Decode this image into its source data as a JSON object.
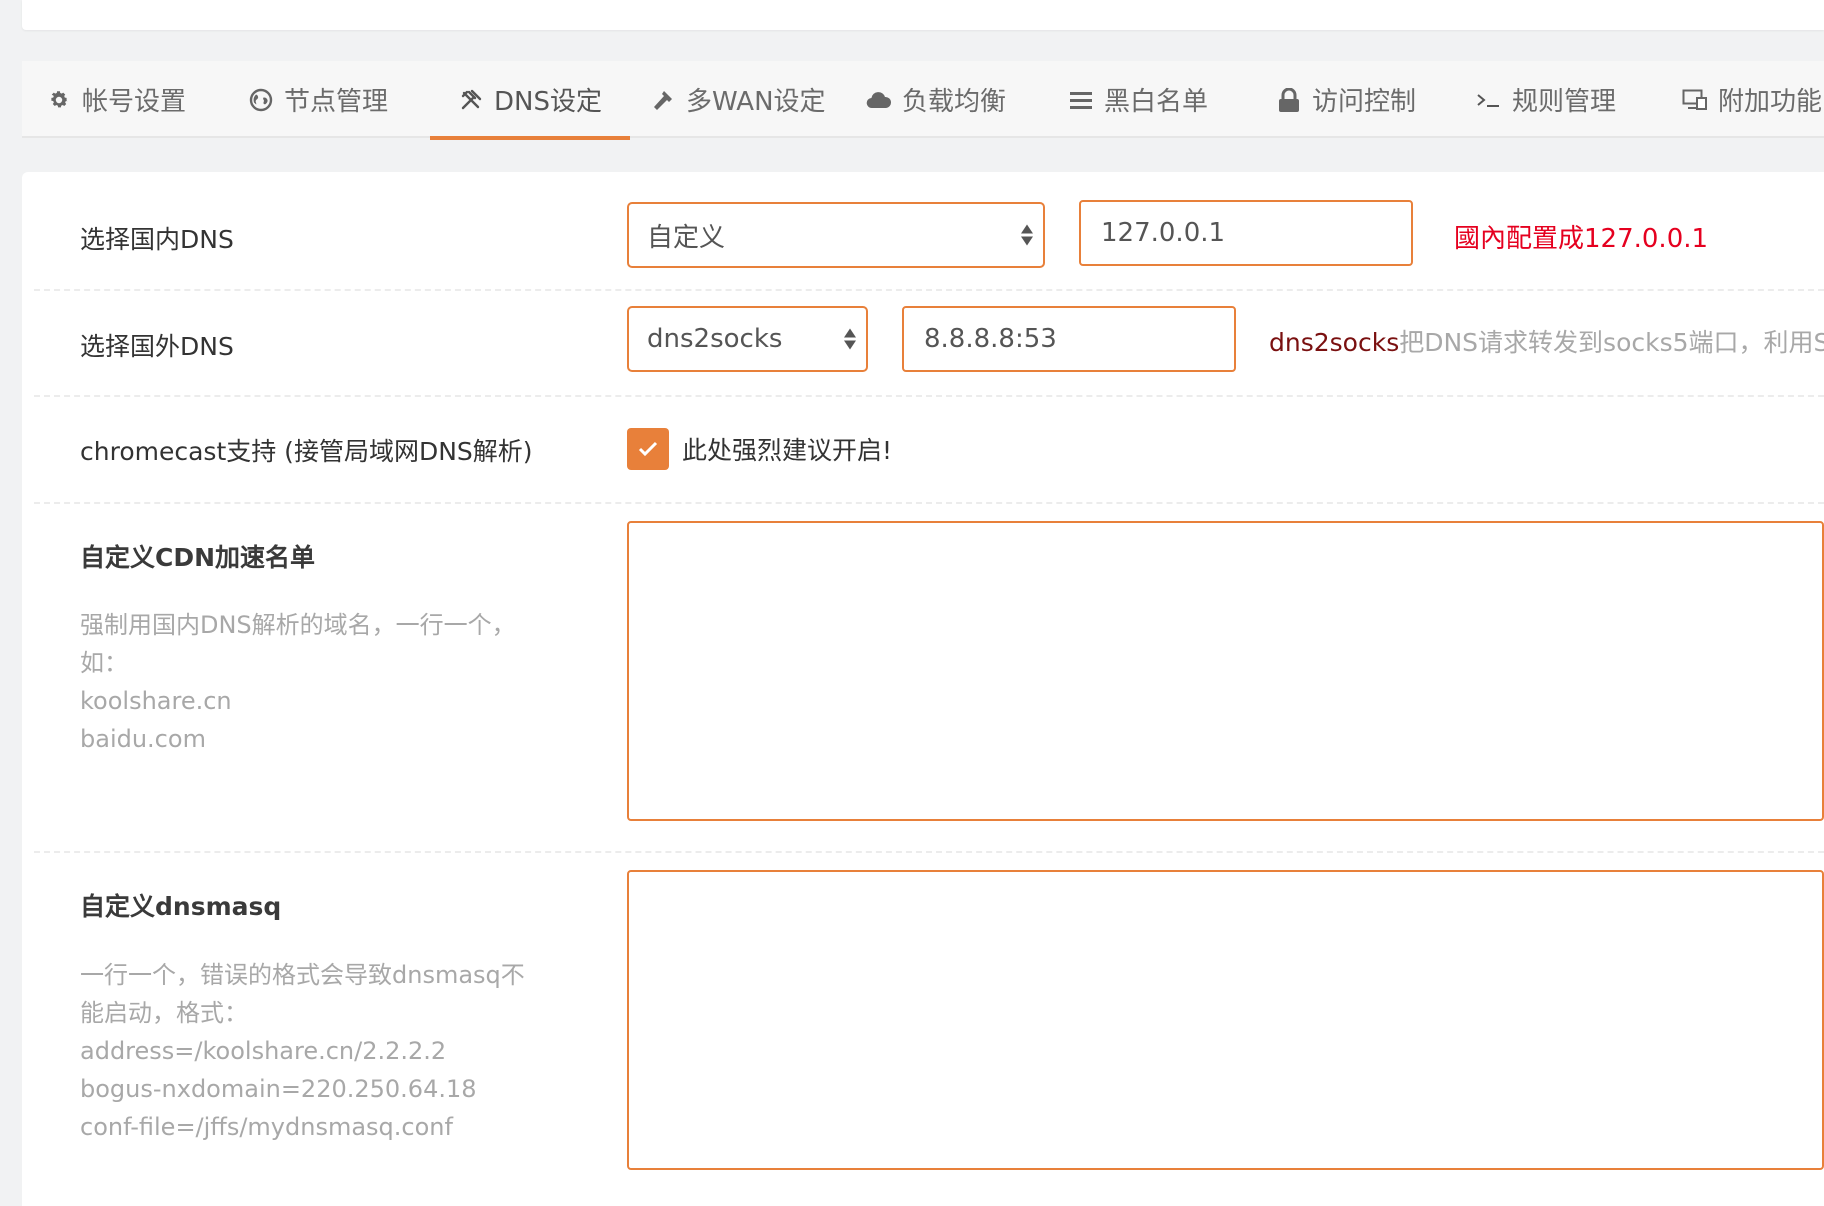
{
  "tabs": [
    {
      "label": "帐号设置",
      "icon": "gear-icon"
    },
    {
      "label": "节点管理",
      "icon": "globe-icon"
    },
    {
      "label": "DNS设定",
      "icon": "tools-icon",
      "active": true
    },
    {
      "label": "多WAN设定",
      "icon": "hammer-icon"
    },
    {
      "label": "负载均衡",
      "icon": "cloud-icon"
    },
    {
      "label": "黑白名单",
      "icon": "list-icon"
    },
    {
      "label": "访问控制",
      "icon": "lock-icon"
    },
    {
      "label": "规则管理",
      "icon": "terminal-icon"
    },
    {
      "label": "附加功能",
      "icon": "monitor-icon"
    }
  ],
  "domestic_dns": {
    "label": "选择国内DNS",
    "select_value": "自定义",
    "input_value": "127.0.0.1",
    "note": "國內配置成127.0.0.1"
  },
  "foreign_dns": {
    "label": "选择国外DNS",
    "select_value": "dns2socks",
    "input_value": "8.8.8.8:53",
    "note_prefix": "dns2socks",
    "note_rest": "把DNS请求转发到socks5端口，利用S"
  },
  "chromecast": {
    "label": "chromecast支持 (接管局域网DNS解析)",
    "checked": true,
    "check_text": "此处强烈建议开启!"
  },
  "cdn_list": {
    "label": "自定义CDN加速名单",
    "hint_lines": [
      "强制用国内DNS解析的域名，一行一个，",
      "如：",
      "koolshare.cn",
      "baidu.com"
    ],
    "value": ""
  },
  "dnsmasq": {
    "label": "自定义dnsmasq",
    "hint_lines": [
      "一行一个，错误的格式会导致dnsmasq不",
      "能启动，格式：",
      "address=/koolshare.cn/2.2.2.2",
      "bogus-nxdomain=220.250.64.18",
      "conf-file=/jffs/mydnsmasq.conf"
    ],
    "value": ""
  },
  "colors": {
    "accent": "#e8803a",
    "warning_red": "#e5001f"
  }
}
